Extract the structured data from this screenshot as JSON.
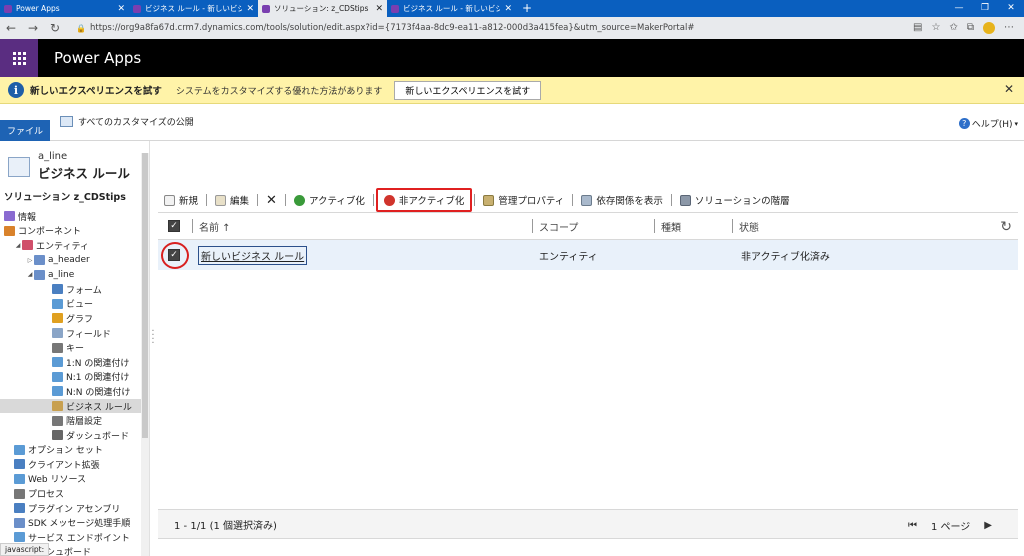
{
  "browser": {
    "tabs": [
      {
        "title": "Power Apps",
        "active": false
      },
      {
        "title": "ビジネス ルール - 新しいビジネス ルール - Micro",
        "active": false
      },
      {
        "title": "ソリューション: z_CDStips - Micros",
        "active": true
      },
      {
        "title": "ビジネス ルール - 新しいビジネス ル",
        "active": false
      }
    ],
    "url": "https://org9a8fa67d.crm7.dynamics.com/tools/solution/edit.aspx?id={7173f4aa-8dc9-ea11-a812-000d3a415fea}&utm_source=MakerPortal#",
    "status_url": "javascript:"
  },
  "app": {
    "title": "Power Apps",
    "accent": "#5a2d81"
  },
  "notification": {
    "title": "新しいエクスペリエンスを試す",
    "message": "システムをカスタマイズする優れた方法があります",
    "button_label": "新しいエクスペリエンスを試す",
    "bg_color": "#fff3a8"
  },
  "ribbon": {
    "file_label": "ファイル",
    "publish_all_label": "すべてのカスタマイズの公開",
    "help_label": "ヘルプ(H)"
  },
  "left_nav": {
    "entity_sub": "a_line",
    "entity_main": "ビジネス ルール",
    "solution_label": "ソリューション z_CDStips",
    "items": [
      {
        "label": "情報",
        "level": 0,
        "icon": "info-icon",
        "color": "#8a6bd1"
      },
      {
        "label": "コンポーネント",
        "level": 0,
        "icon": "components-icon",
        "color": "#d9822b"
      },
      {
        "label": "エンティティ",
        "level": 1,
        "icon": "entities-icon",
        "color": "#d04f6a",
        "expanded": true
      },
      {
        "label": "a_header",
        "level": 2,
        "icon": "entity-icon",
        "color": "#6b8fc9",
        "collapsed": true
      },
      {
        "label": "a_line",
        "level": 2,
        "icon": "entity-icon",
        "color": "#6b8fc9",
        "expanded": true
      },
      {
        "label": "フォーム",
        "level": 3,
        "icon": "form-icon",
        "color": "#4a7fc1"
      },
      {
        "label": "ビュー",
        "level": 3,
        "icon": "view-icon",
        "color": "#5b9bd5"
      },
      {
        "label": "グラフ",
        "level": 3,
        "icon": "chart-icon",
        "color": "#e0a020"
      },
      {
        "label": "フィールド",
        "level": 3,
        "icon": "field-icon",
        "color": "#8aa5c7"
      },
      {
        "label": "キー",
        "level": 3,
        "icon": "key-icon",
        "color": "#777777"
      },
      {
        "label": "1:N の関連付け",
        "level": 3,
        "icon": "relationship-icon",
        "color": "#5b9bd5"
      },
      {
        "label": "N:1 の関連付け",
        "level": 3,
        "icon": "relationship-icon",
        "color": "#5b9bd5"
      },
      {
        "label": "N:N の関連付け",
        "level": 3,
        "icon": "relationship-icon",
        "color": "#5b9bd5"
      },
      {
        "label": "ビジネス ルール",
        "level": 3,
        "icon": "business-rule-icon",
        "color": "#c8a050",
        "selected": true
      },
      {
        "label": "階層設定",
        "level": 3,
        "icon": "hierarchy-icon",
        "color": "#777777"
      },
      {
        "label": "ダッシュボード",
        "level": 3,
        "icon": "dashboard-icon",
        "color": "#666666"
      },
      {
        "label": "オプション セット",
        "level": 1,
        "icon": "optionset-icon",
        "color": "#5b9bd5"
      },
      {
        "label": "クライアント拡張",
        "level": 1,
        "icon": "client-ext-icon",
        "color": "#4a7fc1"
      },
      {
        "label": "Web リソース",
        "level": 1,
        "icon": "web-resource-icon",
        "color": "#5b9bd5"
      },
      {
        "label": "プロセス",
        "level": 1,
        "icon": "process-icon",
        "color": "#777777"
      },
      {
        "label": "プラグイン アセンブリ",
        "level": 1,
        "icon": "plugin-icon",
        "color": "#4a7fc1"
      },
      {
        "label": "SDK メッセージ処理手順",
        "level": 1,
        "icon": "sdk-icon",
        "color": "#6b8fc9"
      },
      {
        "label": "サービス エンドポイント",
        "level": 1,
        "icon": "endpoint-icon",
        "color": "#5b9bd5"
      },
      {
        "label": "ダッシュボード",
        "level": 1,
        "icon": "dashboard-icon",
        "color": "#666666"
      }
    ]
  },
  "toolbar": {
    "new_label": "新規",
    "edit_label": "編集",
    "activate_label": "アクティブ化",
    "deactivate_label": "非アクティブ化",
    "managed_props_label": "管理プロパティ",
    "show_dependencies_label": "依存関係を表示",
    "solution_layers_label": "ソリューションの階層"
  },
  "grid": {
    "columns": [
      "名前 ↑",
      "スコープ",
      "種類",
      "状態"
    ],
    "rows": [
      {
        "name": "新しいビジネス ルール",
        "scope": "エンティティ",
        "type": "",
        "status": "非アクティブ化済み",
        "checked": true
      }
    ],
    "footer_count": "1 - 1/1 (1 個選択済み)",
    "page_label": "1 ページ"
  }
}
